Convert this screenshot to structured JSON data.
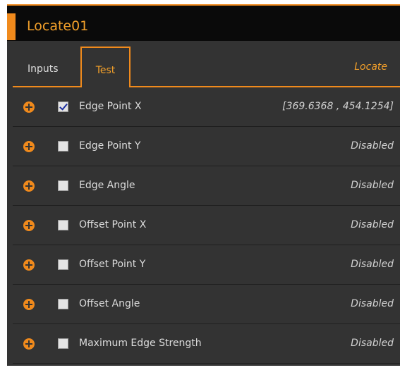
{
  "panel": {
    "title": "Locate01"
  },
  "tabs": {
    "inputs_label": "Inputs",
    "test_label": "Test",
    "locate_label": "Locate"
  },
  "rows": [
    {
      "label": "Edge Point X",
      "value": "[369.6368 , 454.1254]",
      "checked": true
    },
    {
      "label": "Edge Point Y",
      "value": "Disabled",
      "checked": false
    },
    {
      "label": "Edge Angle",
      "value": "Disabled",
      "checked": false
    },
    {
      "label": "Offset Point X",
      "value": "Disabled",
      "checked": false
    },
    {
      "label": "Offset Point Y",
      "value": "Disabled",
      "checked": false
    },
    {
      "label": "Offset Angle",
      "value": "Disabled",
      "checked": false
    },
    {
      "label": "Maximum Edge Strength",
      "value": "Disabled",
      "checked": false
    }
  ],
  "icons": {
    "expand": "plus-circle-icon",
    "checkbox": "checkbox-icon"
  },
  "colors": {
    "accent": "#f08a1c",
    "panel_bg": "#333333",
    "title_bg": "#0a0a0a"
  }
}
